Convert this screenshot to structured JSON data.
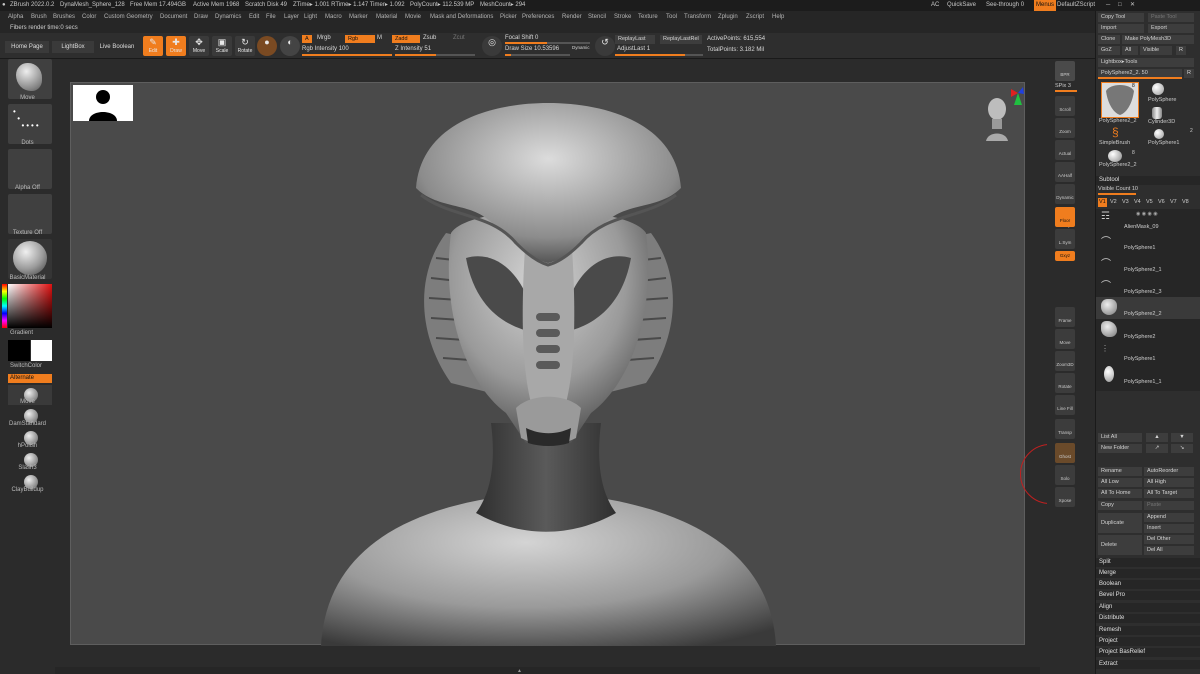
{
  "title_bar": {
    "app": "ZBrush 2022.0.2",
    "document": "DynaMesh_Sphere_128",
    "free_mem": "Free Mem 17.494GB",
    "active_mem": "Active Mem 1968",
    "scratch_disk": "Scratch Disk 49",
    "ztime": "ZTime▸ 1.001 RTime▸ 1.147 Timer▸ 1.092",
    "polycount": "PolyCount▸ 112.539 MP",
    "meshcount": "MeshCount▸ 294",
    "ac": "AC",
    "quicksave": "QuickSave",
    "see_through": "See-through",
    "see_through_value": "0",
    "menus": "Menus",
    "default_zscript": "DefaultZScript"
  },
  "menu": [
    "Alpha",
    "Brush",
    "Brushes",
    "Color",
    "Custom Geometry",
    "Document",
    "Draw",
    "Dynamics",
    "Edit",
    "File",
    "Layer",
    "Light",
    "Macro",
    "Marker",
    "Material",
    "Movie",
    "Mask and Deformations",
    "Picker",
    "Preferences",
    "Render",
    "Stencil",
    "Stroke",
    "Texture",
    "Tool",
    "Transform",
    "Zplugin",
    "Zscript",
    "Help"
  ],
  "status_message": "Fibers render time:0 secs",
  "shelf": {
    "home_page": "Home Page",
    "lightbox": "LightBox",
    "live_boolean": "Live Boolean",
    "edit": "Edit",
    "draw": "Draw",
    "move": "Move",
    "scale": "Scale",
    "rotate": "Rotate",
    "a_label": "A",
    "mrgb": "Mrgb",
    "rgb": "Rgb",
    "m": "M",
    "zadd": "Zadd",
    "zsub": "Zsub",
    "zcut": "Zcut",
    "rgb_intensity_label": "Rgb Intensity",
    "rgb_intensity": "100",
    "z_intensity_label": "Z Intensity",
    "z_intensity": "51",
    "focal_shift_label": "Focal Shift",
    "focal_shift": "0",
    "draw_size_label": "Draw Size",
    "draw_size": "10.53596",
    "dynamic": "Dynamic",
    "replay_last": "ReplayLast",
    "replay_last_rel": "ReplayLastRel",
    "adjust_last_label": "AdjustLast",
    "adjust_last": "1",
    "active_points": "ActivePoints: 615,554",
    "total_points": "TotalPoints: 3.182 Mil"
  },
  "left_panel": {
    "move": "Move",
    "dots": "Dots",
    "alpha_off": "Alpha Off",
    "texture_off": "Texture Off",
    "basic_material": "BasicMaterial",
    "gradient": "Gradient",
    "switch_color": "SwitchColor",
    "alternate": "Alternate",
    "brushes": [
      "Move",
      "DamStandard",
      "hPolish",
      "Slash3",
      "ClayBuildup"
    ]
  },
  "right_bar": {
    "spix": "SPix 3",
    "items": [
      "BPR",
      "Scroll",
      "Zoom",
      "Actual",
      "AAHalf",
      "Dynamic Persp",
      "Floor",
      "L.Sym",
      "Gxyz",
      "Frame",
      "Move",
      "Zoom3D",
      "Rotate",
      "Line Fill PolyF",
      "Transp",
      "Ghost",
      "Solo",
      "Xpose"
    ]
  },
  "tray": {
    "copy_tool": "Copy Tool",
    "paste_tool": "Paste Tool",
    "import": "Import",
    "export": "Export",
    "clone": "Clone",
    "make_polymesh": "Make PolyMesh3D",
    "goz": "GoZ",
    "all": "All",
    "visible": "Visible",
    "r": "R",
    "lightbox_tools": "Lightbox▸Tools",
    "current_tool": "PolySphere2_2. 50",
    "tool_thumbs": [
      {
        "label": "PolySphere2_2",
        "count": "8"
      },
      {
        "label": "PolySphere",
        "count": ""
      },
      {
        "label": "Cylinder3D",
        "count": ""
      },
      {
        "label": "SimpleBrush",
        "count": ""
      },
      {
        "label": "PolySphere1",
        "count": "2"
      },
      {
        "label": "PolySphere2_2",
        "count": "8"
      }
    ],
    "subtool_header": "Subtool",
    "visible_count": "Visible Count 10",
    "versions": [
      "V1",
      "V2",
      "V3",
      "V4",
      "V5",
      "V6",
      "V7",
      "V8"
    ],
    "subtools": [
      "AlienMask_09",
      "PolySphere1",
      "PolySphere2_1",
      "PolySphere2_3",
      "PolySphere2_2",
      "PolySphere2",
      "PolySphere1",
      "PolySphere1_1"
    ],
    "list_all": "List All",
    "new_folder": "New Folder",
    "rename": "Rename",
    "auto_reorder": "AutoReorder",
    "all_low": "All Low",
    "all_high": "All High",
    "all_to_home": "All To Home",
    "all_to_target": "All To Target",
    "copy": "Copy",
    "paste": "Paste",
    "duplicate": "Duplicate",
    "append": "Append",
    "insert": "Insert",
    "delete": "Delete",
    "del_other": "Del Other",
    "del_all": "Del All",
    "sections": [
      "Split",
      "Merge",
      "Boolean",
      "Bevel Pro",
      "Align",
      "Distribute",
      "Remesh",
      "Project",
      "Project BasRelief",
      "Extract"
    ]
  },
  "colors": {
    "accent": "#f07d1e",
    "bg": "#2b2b2b",
    "canvas": "#4a4a4a"
  }
}
